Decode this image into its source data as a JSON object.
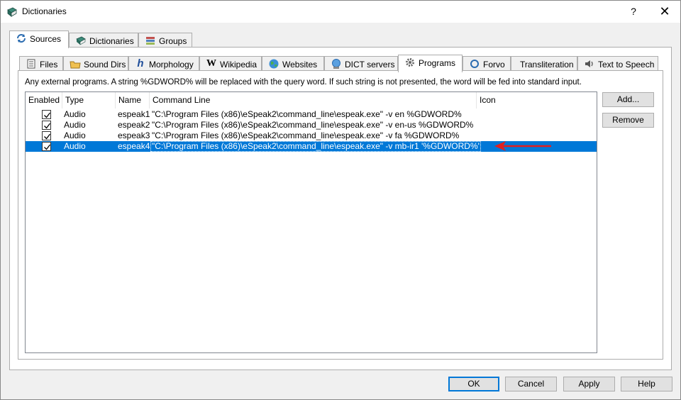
{
  "window": {
    "title": "Dictionaries",
    "help_label": "?",
    "close_label": "✕"
  },
  "main_tabs": [
    {
      "label": "Sources",
      "icon": "sources-icon",
      "selected": true
    },
    {
      "label": "Dictionaries",
      "icon": "dictionary-book-icon",
      "selected": false
    },
    {
      "label": "Groups",
      "icon": "groups-icon",
      "selected": false
    }
  ],
  "sub_tabs": [
    {
      "label": "Files",
      "icon": "files-icon"
    },
    {
      "label": "Sound Dirs",
      "icon": "sound-dirs-icon"
    },
    {
      "label": "Morphology",
      "icon": "morphology-icon"
    },
    {
      "label": "Wikipedia",
      "icon": "wikipedia-icon"
    },
    {
      "label": "Websites",
      "icon": "globe-icon"
    },
    {
      "label": "DICT servers",
      "icon": "dict-servers-icon"
    },
    {
      "label": "Programs",
      "icon": "gear-icon",
      "selected": true
    },
    {
      "label": "Forvo",
      "icon": "forvo-icon"
    },
    {
      "label": "Transliteration",
      "icon": ""
    },
    {
      "label": "Text to Speech",
      "icon": "speaker-icon"
    }
  ],
  "programs": {
    "info": "Any external programs. A string %GDWORD% will be replaced with the query word. If such string is not presented, the word will be fed into standard input.",
    "columns": [
      "Enabled",
      "Type",
      "Name",
      "Command Line",
      "Icon"
    ],
    "rows": [
      {
        "enabled": true,
        "type": "Audio",
        "name": "espeak1",
        "command": "\"C:\\Program Files (x86)\\eSpeak2\\command_line\\espeak.exe\" -v en %GDWORD%",
        "selected": false
      },
      {
        "enabled": true,
        "type": "Audio",
        "name": "espeak2",
        "command": "\"C:\\Program Files (x86)\\eSpeak2\\command_line\\espeak.exe\" -v en-us %GDWORD%",
        "selected": false
      },
      {
        "enabled": true,
        "type": "Audio",
        "name": "espeak3",
        "command": "\"C:\\Program Files (x86)\\eSpeak2\\command_line\\espeak.exe\" -v fa %GDWORD%",
        "selected": false
      },
      {
        "enabled": true,
        "type": "Audio",
        "name": "espeak4",
        "command": "\"C:\\Program Files (x86)\\eSpeak2\\command_line\\espeak.exe\" -v mb-ir1 '%GDWORD%'",
        "selected": true
      }
    ],
    "add_label": "Add...",
    "remove_label": "Remove"
  },
  "footer": {
    "ok": "OK",
    "cancel": "Cancel",
    "apply": "Apply",
    "help": "Help"
  },
  "colors": {
    "selection": "#0078d7",
    "arrow": "#e02020",
    "accent": "#0078d7"
  }
}
